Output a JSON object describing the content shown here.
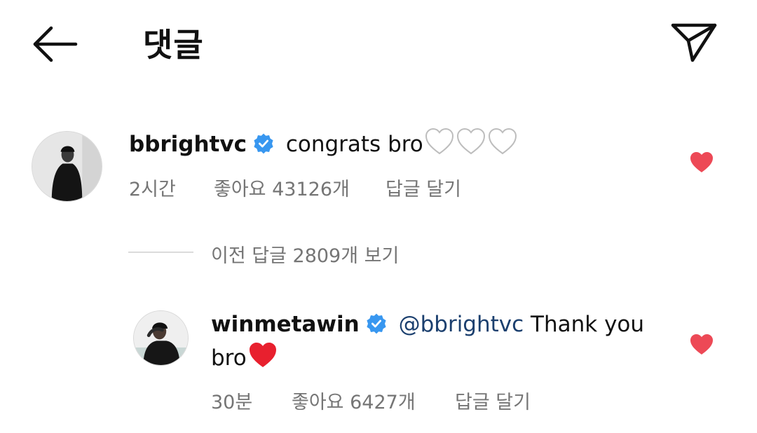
{
  "header": {
    "title": "댓글",
    "back_icon": "arrow-left-icon",
    "share_icon": "send-icon"
  },
  "comment": {
    "username": "bbrightvc",
    "text": "congrats bro",
    "emoji": [
      "white-heart",
      "white-heart",
      "white-heart"
    ],
    "time": "2시간",
    "likes": "좋아요 43126개",
    "reply": "답글 달기",
    "liked": true
  },
  "view_replies": "이전 답글 2809개 보기",
  "reply": {
    "username": "winmetawin",
    "mention": "@bbrightvc",
    "text_line1": " Thank you",
    "text_line2": "bro",
    "emoji": "red-heart",
    "time": "30분",
    "likes": "좋아요 6427개",
    "reply": "답글 달기",
    "liked": true
  },
  "colors": {
    "verified_badge": "#3897f0",
    "like_heart": "#ed4956",
    "meta_text": "#757575",
    "mention": "#1b3f6e"
  }
}
